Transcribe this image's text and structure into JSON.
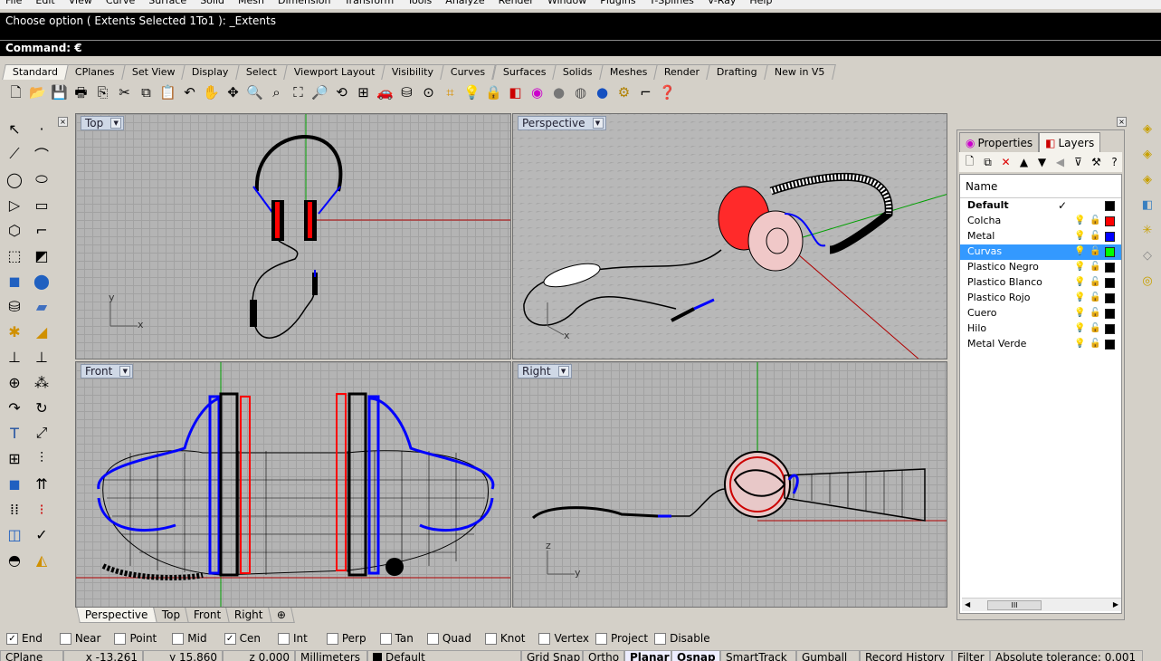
{
  "menu": [
    "File",
    "Edit",
    "View",
    "Curve",
    "Surface",
    "Solid",
    "Mesh",
    "Dimension",
    "Transform",
    "Tools",
    "Analyze",
    "Render",
    "Window",
    "Plugins",
    "T-Splines",
    "V-Ray",
    "Help"
  ],
  "command": {
    "history": "Choose option ( Extents  Selected  1To1 ): _Extents",
    "prompt": "Command: €"
  },
  "toolbar_tabs": [
    "Standard",
    "CPlanes",
    "Set View",
    "Display",
    "Select",
    "Viewport Layout",
    "Visibility",
    "Curves",
    "Surfaces",
    "Solids",
    "Meshes",
    "Render",
    "Drafting",
    "New in V5"
  ],
  "toolbar_icons": [
    "new-file-icon",
    "open-folder-icon",
    "save-icon",
    "print-icon",
    "import-icon",
    "cut-icon",
    "copy-icon",
    "paste-icon",
    "undo-icon",
    "pan-hand-icon",
    "rotate-view-icon",
    "zoom-icon",
    "zoom-window-icon",
    "zoom-extents-icon",
    "zoom-selected-icon",
    "rotate-camera-icon",
    "four-viewports-icon",
    "car-icon",
    "flat-shade-icon",
    "object-snap-icon",
    "osnap-points-icon",
    "light-bulb-icon",
    "lock-icon",
    "layer-icon",
    "color-wheel-icon",
    "rendered-sphere-icon",
    "ghosted-sphere-icon",
    "shaded-sphere-icon",
    "gear-icon",
    "history-icon",
    "help-icon"
  ],
  "viewports": {
    "top": {
      "label": "Top"
    },
    "perspective": {
      "label": "Perspective"
    },
    "front": {
      "label": "Front"
    },
    "right": {
      "label": "Right"
    }
  },
  "axes": {
    "x": "x",
    "y": "y",
    "z": "z"
  },
  "viewport_tabs": [
    "Perspective",
    "Top",
    "Front",
    "Right"
  ],
  "panel": {
    "tabs": [
      "Properties",
      "Layers"
    ],
    "column_name": "Name",
    "layers": [
      {
        "name": "Default",
        "current": true,
        "color": "#000000"
      },
      {
        "name": "Colcha",
        "color": "#ff0000"
      },
      {
        "name": "Metal",
        "color": "#0000ff"
      },
      {
        "name": "Curvas",
        "color": "#00ff00",
        "selected": true
      },
      {
        "name": "Plastico Negro",
        "color": "#000000"
      },
      {
        "name": "Plastico Blanco",
        "color": "#000000"
      },
      {
        "name": "Plastico Rojo",
        "color": "#000000"
      },
      {
        "name": "Cuero",
        "color": "#000000"
      },
      {
        "name": "Hilo",
        "color": "#000000"
      },
      {
        "name": "Metal Verde",
        "color": "#000000"
      }
    ],
    "checkmark": "✓",
    "scroll_thumb": "III"
  },
  "osnaps": [
    {
      "label": "End",
      "checked": true
    },
    {
      "label": "Near",
      "checked": false
    },
    {
      "label": "Point",
      "checked": false
    },
    {
      "label": "Mid",
      "checked": false
    },
    {
      "label": "Cen",
      "checked": true
    },
    {
      "label": "Int",
      "checked": false
    },
    {
      "label": "Perp",
      "checked": false
    },
    {
      "label": "Tan",
      "checked": false
    },
    {
      "label": "Quad",
      "checked": false
    },
    {
      "label": "Knot",
      "checked": false
    },
    {
      "label": "Vertex",
      "checked": false
    },
    {
      "label": "Project",
      "checked": false
    },
    {
      "label": "Disable",
      "checked": false
    }
  ],
  "status": {
    "cplane": "CPlane",
    "x": "x -13.261",
    "y": "y 15.860",
    "z": "z 0.000",
    "units": "Millimeters",
    "layer": "Default",
    "grid_snap": "Grid Snap",
    "ortho": "Ortho",
    "planar": "Planar",
    "osnap": "Osnap",
    "smarttrack": "SmartTrack",
    "gumball": "Gumball",
    "record_history": "Record History",
    "filter": "Filter",
    "tolerance": "Absolute tolerance: 0.001"
  },
  "colors": {
    "wire": "#000000",
    "curve": "#0000ff",
    "accent": "#ff0000",
    "axis_x": "#b00000",
    "axis_y": "#00a000",
    "selection": "#3399ff"
  }
}
